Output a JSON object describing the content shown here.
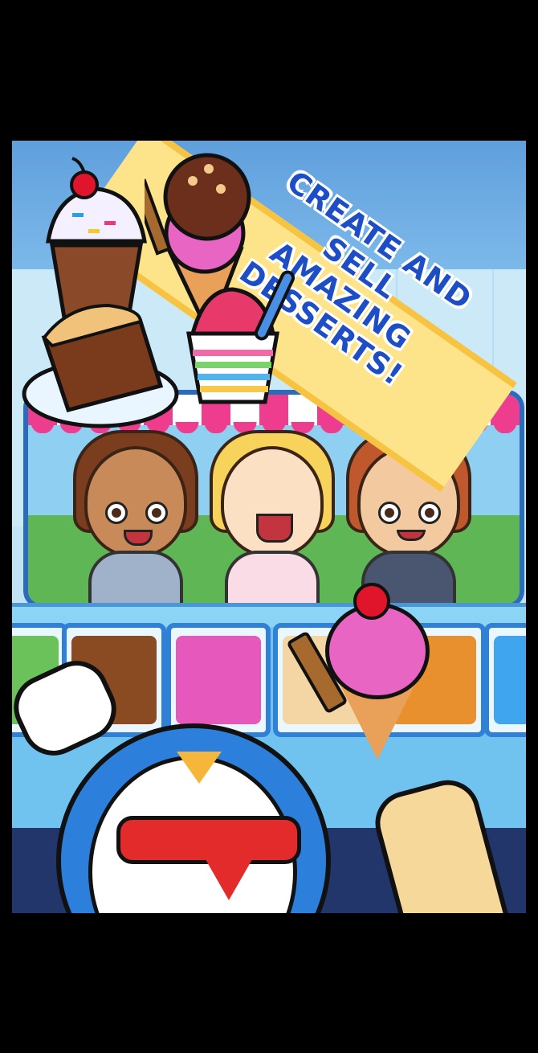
{
  "banner": {
    "line1": "CREATE AND SELL",
    "line2": "AMAZING DESSERTS!"
  },
  "colors": {
    "banner_text": "#1d4ec6",
    "banner_bg": "#fde38a",
    "awning_pink": "#ee3d8f",
    "counter_blue": "#6fc3ee",
    "penguin_blue": "#2d7fdc",
    "scarf_red": "#e42b2b"
  },
  "desserts": [
    "milkshake-icon",
    "ice-cream-cone-icon",
    "brownie-icon",
    "shaved-ice-cup-icon"
  ],
  "customers": [
    "customer-brown-hair",
    "customer-blonde-hair",
    "customer-red-hair"
  ],
  "flavor_bins": [
    {
      "name": "mint",
      "color": "#6cc25a"
    },
    {
      "name": "chocolate",
      "color": "#8a4a22"
    },
    {
      "name": "strawberry",
      "color": "#e658bb"
    },
    {
      "name": "vanilla",
      "color": "#f4d6a4"
    },
    {
      "name": "caramel",
      "color": "#e8902e"
    },
    {
      "name": "blueberry",
      "color": "#3fa5ef"
    }
  ]
}
